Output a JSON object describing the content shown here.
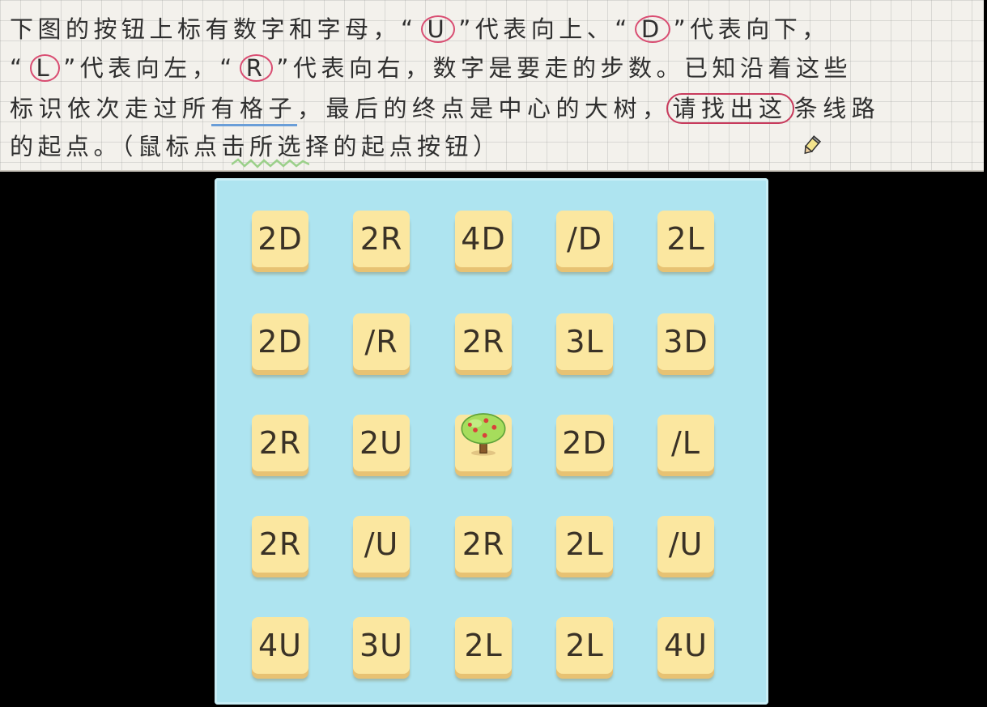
{
  "instructions": {
    "line1_a": "下图的按钮上标有数字和字母，“",
    "U": "U",
    "line1_b": "”代表向上、“",
    "D": "D",
    "line1_c": "”代表向下，",
    "line2_a": "“",
    "L": "L",
    "line2_b": "”代表向左，“",
    "R": "R",
    "line2_c": "”代表向右，数字是要走的步数。已知沿着这些",
    "line3_a": "标识依次走过所",
    "line3_underlined": "有格子",
    "line3_b": "，最后的终点是中心的大树，",
    "line3_circled": "请找出这",
    "line3_c": "条线路",
    "line4": "的起点。（鼠标点击所选择的起点按钮）"
  },
  "colors": {
    "board": "#aee4f0",
    "tile": "#fbe7a0",
    "tile_shadow": "#e7c273",
    "circle_mark": "#d94d72",
    "underline_mark": "#6a9ed8"
  },
  "board": {
    "rows": [
      [
        "2D",
        "2R",
        "4D",
        "/D",
        "2L"
      ],
      [
        "2D",
        "/R",
        "2R",
        "3L",
        "3D"
      ],
      [
        "2R",
        "2U",
        "tree",
        "2D",
        "/L"
      ],
      [
        "2R",
        "/U",
        "2R",
        "2L",
        "/U"
      ],
      [
        "4U",
        "3U",
        "2L",
        "2L",
        "4U"
      ]
    ]
  }
}
